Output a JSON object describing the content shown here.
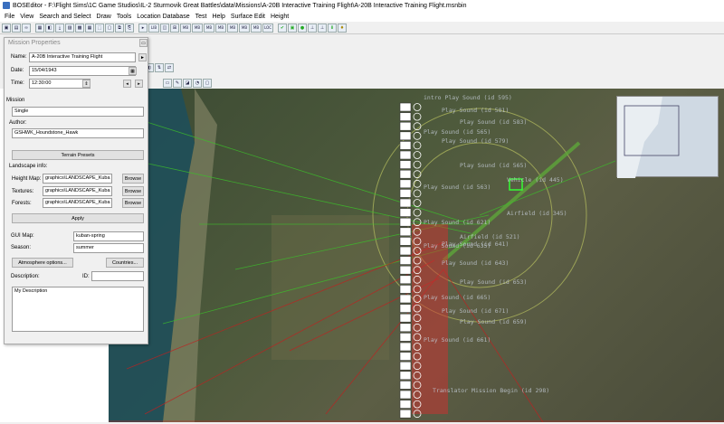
{
  "window": {
    "title": "BOSEditor - F:\\Flight Sims\\1C Game Studios\\IL-2 Sturmovik Great Battles\\data\\Missions\\A-20B Interactive Training Flight\\A-20B Interactive Training Flight.msnbin"
  },
  "menu": [
    "File",
    "View",
    "Search and Select",
    "Draw",
    "Tools",
    "Location Database",
    "Test",
    "Help",
    "Surface Edit",
    "Height"
  ],
  "toolbar": {
    "text_buttons": [
      "LIB",
      "MB",
      "MB",
      "MB",
      "MB",
      "MB",
      "MB",
      "MB",
      "LOC"
    ]
  },
  "mission_properties": {
    "title": "Mission Properties",
    "name_label": "Name:",
    "name_value": "A-20B Interactive Training Flight",
    "date_label": "Date:",
    "date_value": "15/04/1943",
    "time_label": "Time:",
    "time_value": "12:30:00",
    "mission_label": "Mission",
    "mission_type": "Single",
    "author_label": "Author:",
    "author_value": "GSHWK_Houndstone_Hawk",
    "terrain_presets_label": "Terrain Presets",
    "landscape_info_label": "Landscape info:",
    "height_map_label": "Height Map:",
    "height_map_value": "graphics\\LANDSCAPE_Kuba",
    "textures_label": "Textures:",
    "textures_value": "graphics\\LANDSCAPE_Kuba",
    "forests_label": "Forests:",
    "forests_value": "graphics\\LANDSCAPE_Kuba",
    "browse_label": "Browse",
    "apply_label": "Apply",
    "gui_map_label": "GUI Map:",
    "gui_map_value": "kuban-spring",
    "season_label": "Season:",
    "season_value": "summer",
    "atmosphere_label": "Atmosphere options...",
    "countries_label": "Countries...",
    "description_label": "Description:",
    "id_label": "ID:",
    "description_value": "My Description"
  },
  "map_labels": [
    "intro Play Sound (id 595)",
    "Play Sound (id 581)",
    "Play Sound (id 583)",
    "Play Sound (id 565)",
    "Play Sound (id 579)",
    "Play Sound (id 565)",
    "Play Sound (id 563)",
    "Vehicle (id 445)",
    "Airfield (id 345)",
    "Play Sound (id 621)",
    "Play Sound (id 641)",
    "Airfield (id 521)",
    "Play Sound (id 635)",
    "Play Sound (id 643)",
    "Play Sound (id 653)",
    "Play Sound (id 665)",
    "Play Sound (id 671)",
    "Play Sound (id 659)",
    "Play Sound (id 661)",
    "Translator Mission Begin (id 298)"
  ]
}
